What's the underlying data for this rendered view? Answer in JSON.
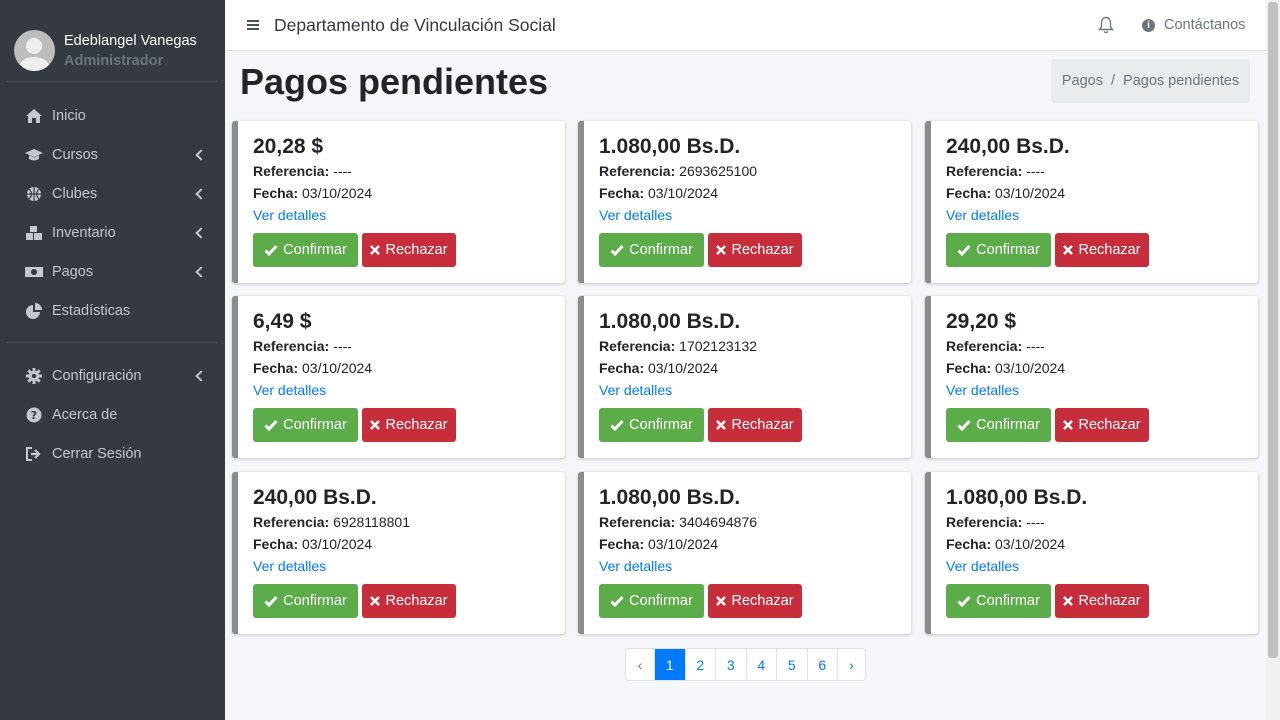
{
  "user": {
    "name": "Edeblangel Vanegas",
    "role": "Administrador"
  },
  "sidebar": {
    "items": [
      {
        "label": "Inicio",
        "icon": "home-icon",
        "chevron": false
      },
      {
        "label": "Cursos",
        "icon": "graduation-cap-icon",
        "chevron": true
      },
      {
        "label": "Clubes",
        "icon": "basketball-icon",
        "chevron": true
      },
      {
        "label": "Inventario",
        "icon": "boxes-icon",
        "chevron": true
      },
      {
        "label": "Pagos",
        "icon": "money-bill-icon",
        "chevron": true
      },
      {
        "label": "Estadísticas",
        "icon": "pie-chart-icon",
        "chevron": false
      }
    ],
    "bottom_items": [
      {
        "label": "Configuración",
        "icon": "gear-icon",
        "chevron": true
      },
      {
        "label": "Acerca de",
        "icon": "question-circle-icon",
        "chevron": false
      },
      {
        "label": "Cerrar Sesión",
        "icon": "sign-out-icon",
        "chevron": false
      }
    ]
  },
  "header": {
    "title": "Departamento de Vinculación Social",
    "contact_label": "Contáctanos"
  },
  "page": {
    "title": "Pagos pendientes"
  },
  "breadcrumb": {
    "parent": "Pagos",
    "separator": "/",
    "current": "Pagos pendientes"
  },
  "labels": {
    "referencia": "Referencia:",
    "fecha": "Fecha:",
    "details": "Ver detalles",
    "confirm": "Confirmar",
    "reject": "Rechazar"
  },
  "payments": [
    {
      "amount": "20,28 $",
      "reference": "----",
      "date": "03/10/2024"
    },
    {
      "amount": "1.080,00 Bs.D.",
      "reference": "2693625100",
      "date": "03/10/2024"
    },
    {
      "amount": "240,00 Bs.D.",
      "reference": "----",
      "date": "03/10/2024"
    },
    {
      "amount": "6,49 $",
      "reference": "----",
      "date": "03/10/2024"
    },
    {
      "amount": "1.080,00 Bs.D.",
      "reference": "1702123132",
      "date": "03/10/2024"
    },
    {
      "amount": "29,20 $",
      "reference": "----",
      "date": "03/10/2024"
    },
    {
      "amount": "240,00 Bs.D.",
      "reference": "6928118801",
      "date": "03/10/2024"
    },
    {
      "amount": "1.080,00 Bs.D.",
      "reference": "3404694876",
      "date": "03/10/2024"
    },
    {
      "amount": "1.080,00 Bs.D.",
      "reference": "----",
      "date": "03/10/2024"
    }
  ],
  "pagination": {
    "prev": "‹",
    "pages": [
      "1",
      "2",
      "3",
      "4",
      "5",
      "6"
    ],
    "next": "›",
    "active": "1"
  },
  "colors": {
    "sidebar": "#343a40",
    "confirm": "#5cad4a",
    "reject": "#c82d3c",
    "link": "#007bff"
  }
}
